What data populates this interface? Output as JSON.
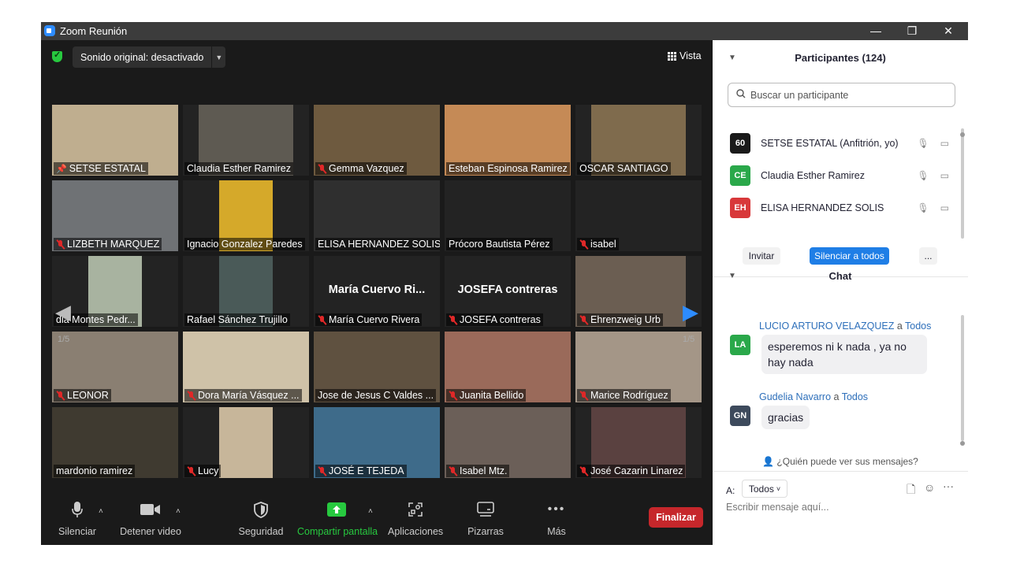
{
  "window": {
    "title": "Zoom Reunión",
    "controls": {
      "minimize": "—",
      "restore": "❐",
      "close": "✕"
    }
  },
  "topbar": {
    "sound_label": "Sonido original: desactivado",
    "view_label": "Vista"
  },
  "pages": {
    "left": "1/5",
    "right": "1/5"
  },
  "tiles": [
    {
      "name": "SETSE ESTATAL",
      "muted": false,
      "pinned": true
    },
    {
      "name": "Claudia Esther Ramirez",
      "muted": false
    },
    {
      "name": "Gemma Vazquez",
      "muted": true
    },
    {
      "name": "Esteban Espinosa Ramirez",
      "muted": false
    },
    {
      "name": "OSCAR SANTIAGO",
      "muted": false,
      "speaking": true
    },
    {
      "name": "LIZBETH MARQUEZ",
      "muted": true
    },
    {
      "name": "Ignacio Gonzalez Paredes",
      "muted": false
    },
    {
      "name": "ELISA HERNANDEZ SOLIS",
      "muted": false
    },
    {
      "name": "Prócoro Bautista Pérez",
      "muted": false
    },
    {
      "name": "isabel",
      "muted": true
    },
    {
      "name": "dia Montes Pedr...",
      "muted": false
    },
    {
      "name": "Rafael Sánchez Trujillo",
      "muted": false,
      "speaking": true
    },
    {
      "name": "María Cuervo Rivera",
      "muted": true,
      "big": "María Cuervo Ri..."
    },
    {
      "name": "JOSEFA contreras",
      "muted": true,
      "big": "JOSEFA contreras"
    },
    {
      "name": "Ehrenzweig Urb",
      "muted": true
    },
    {
      "name": "LEONOR",
      "muted": true
    },
    {
      "name": "Dora María Vásquez ...",
      "muted": true
    },
    {
      "name": "Jose de Jesus C Valdes ...",
      "muted": false,
      "active": true
    },
    {
      "name": "Juanita Bellido",
      "muted": true
    },
    {
      "name": "Marice Rodríguez",
      "muted": true
    },
    {
      "name": "mardonio ramirez",
      "muted": false
    },
    {
      "name": "Lucy",
      "muted": true
    },
    {
      "name": "JOSÉ  E TEJEDA",
      "muted": true
    },
    {
      "name": "Isabel Mtz.",
      "muted": true
    },
    {
      "name": "José Cazarin Linarez",
      "muted": true
    }
  ],
  "toolbar": {
    "mute": "Silenciar",
    "video": "Detener video",
    "security": "Seguridad",
    "share": "Compartir pantalla",
    "apps": "Aplicaciones",
    "whiteboards": "Pizarras",
    "more": "Más",
    "end": "Finalizar"
  },
  "participants": {
    "title": "Participantes (124)",
    "search_placeholder": "Buscar un participante",
    "list": [
      {
        "initials": "60",
        "name": "SETSE ESTATAL (Anfitrión, yo)",
        "color": "#1a1a1a"
      },
      {
        "initials": "CE",
        "name": "Claudia Esther Ramirez",
        "color": "#2aa84a"
      },
      {
        "initials": "EH",
        "name": "ELISA HERNANDEZ SOLIS",
        "color": "#d8383a"
      }
    ],
    "invite": "Invitar",
    "mute_all": "Silenciar a todos",
    "more": "..."
  },
  "chat": {
    "title": "Chat",
    "messages": [
      {
        "initials": "LA",
        "from": "LUCIO ARTURO VELAZQUEZ",
        "a": "a",
        "to": "Todos",
        "text": "esperemos ni k nada , ya no hay nada",
        "color": "#2aa84a"
      },
      {
        "initials": "GN",
        "from": "Gudelia Navarro",
        "a": "a",
        "to": "Todos",
        "text": "gracias",
        "color": "#3d4a5c"
      }
    ],
    "who_can_see": "¿Quién puede ver sus mensajes?",
    "to_label": "A:",
    "to_value": "Todos",
    "input_placeholder": "Escribir mensaje aquí..."
  }
}
